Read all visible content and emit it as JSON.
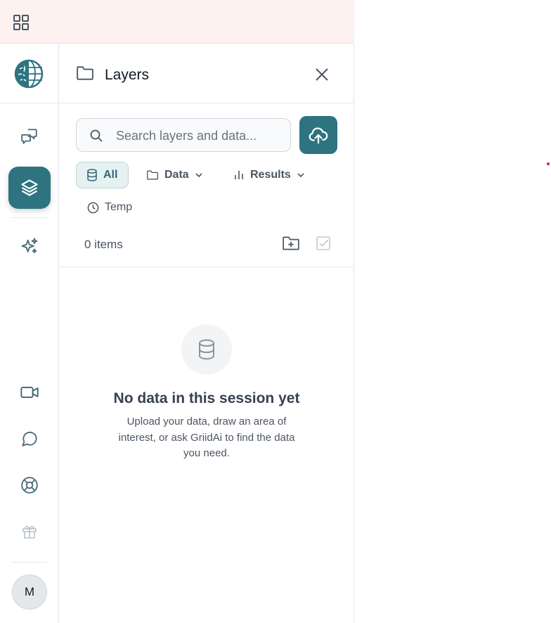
{
  "topbar": {
    "apps_icon": "grid-icon"
  },
  "rail": {
    "items": [
      {
        "id": "chat",
        "icon": "chat-bubbles-icon"
      },
      {
        "id": "layers",
        "icon": "layers-icon",
        "active": true
      },
      {
        "id": "ai",
        "icon": "sparkles-icon"
      },
      {
        "id": "video",
        "icon": "video-icon"
      },
      {
        "id": "feedback",
        "icon": "message-icon"
      },
      {
        "id": "help",
        "icon": "lifebuoy-icon"
      },
      {
        "id": "gift",
        "icon": "gift-icon"
      }
    ],
    "avatar_initial": "M"
  },
  "panel": {
    "title": "Layers",
    "search": {
      "placeholder": "Search layers and data..."
    },
    "filters": [
      {
        "label": "All",
        "icon": "database-icon",
        "active": true
      },
      {
        "label": "Data",
        "icon": "folder-icon",
        "dropdown": true
      },
      {
        "label": "Results",
        "icon": "bar-chart-icon",
        "dropdown": true
      },
      {
        "label": "Temp",
        "icon": "clock-icon"
      }
    ],
    "items_count": "0 items",
    "empty_state": {
      "title": "No data in this session yet",
      "description": "Upload your data, draw an area of interest, or ask GriidAi to find the data you need."
    }
  },
  "colors": {
    "accent": "#2d7480",
    "topbar_bg": "#fdf2ef"
  }
}
